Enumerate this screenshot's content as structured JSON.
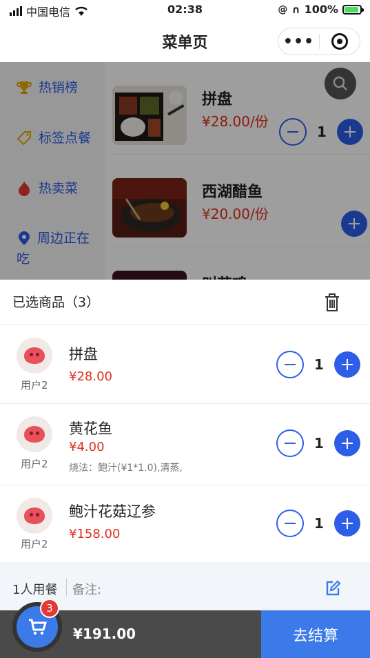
{
  "status_bar": {
    "carrier": "中国电信",
    "time": "02:38",
    "battery": "100%"
  },
  "nav": {
    "title": "菜单页",
    "more_icon": "more-dots-icon",
    "capsule_icon": "target-icon"
  },
  "sidebar": {
    "items": [
      {
        "label": "热销榜",
        "icon": "trophy-icon",
        "color": "#e0a800"
      },
      {
        "label": "标签点餐",
        "icon": "tag-icon",
        "color": "#e0a800"
      },
      {
        "label": "热卖菜",
        "icon": "flame-icon",
        "color": "#e53935"
      },
      {
        "label": "周边正在吃",
        "icon": "location-pin-icon",
        "color": "#2e5de8"
      }
    ]
  },
  "menu": {
    "dishes": [
      {
        "name": "拼盘",
        "price": "¥28.00/份",
        "qty": "1"
      },
      {
        "name": "西湖醋鱼",
        "price": "¥20.00/份"
      },
      {
        "name": "叫花鸡"
      }
    ]
  },
  "cart": {
    "title": "已选商品（3）",
    "items": [
      {
        "user": "用户2",
        "name": "拼盘",
        "price": "¥28.00",
        "note": "",
        "qty": "1"
      },
      {
        "user": "用户2",
        "name": "黄花鱼",
        "price": "¥4.00",
        "note": "烧法：鲍汁(¥1*1.0),清蒸,",
        "qty": "1"
      },
      {
        "user": "用户2",
        "name": "鲍汁花菇辽参",
        "price": "¥158.00",
        "note": "",
        "qty": "1"
      }
    ],
    "diners": "1人用餐",
    "remark_label": "备注:",
    "badge": "3",
    "total": "¥191.00",
    "checkout": "去结算"
  },
  "colors": {
    "accent": "#3b7ae8",
    "price": "#e0301e",
    "badge": "#e53935"
  }
}
